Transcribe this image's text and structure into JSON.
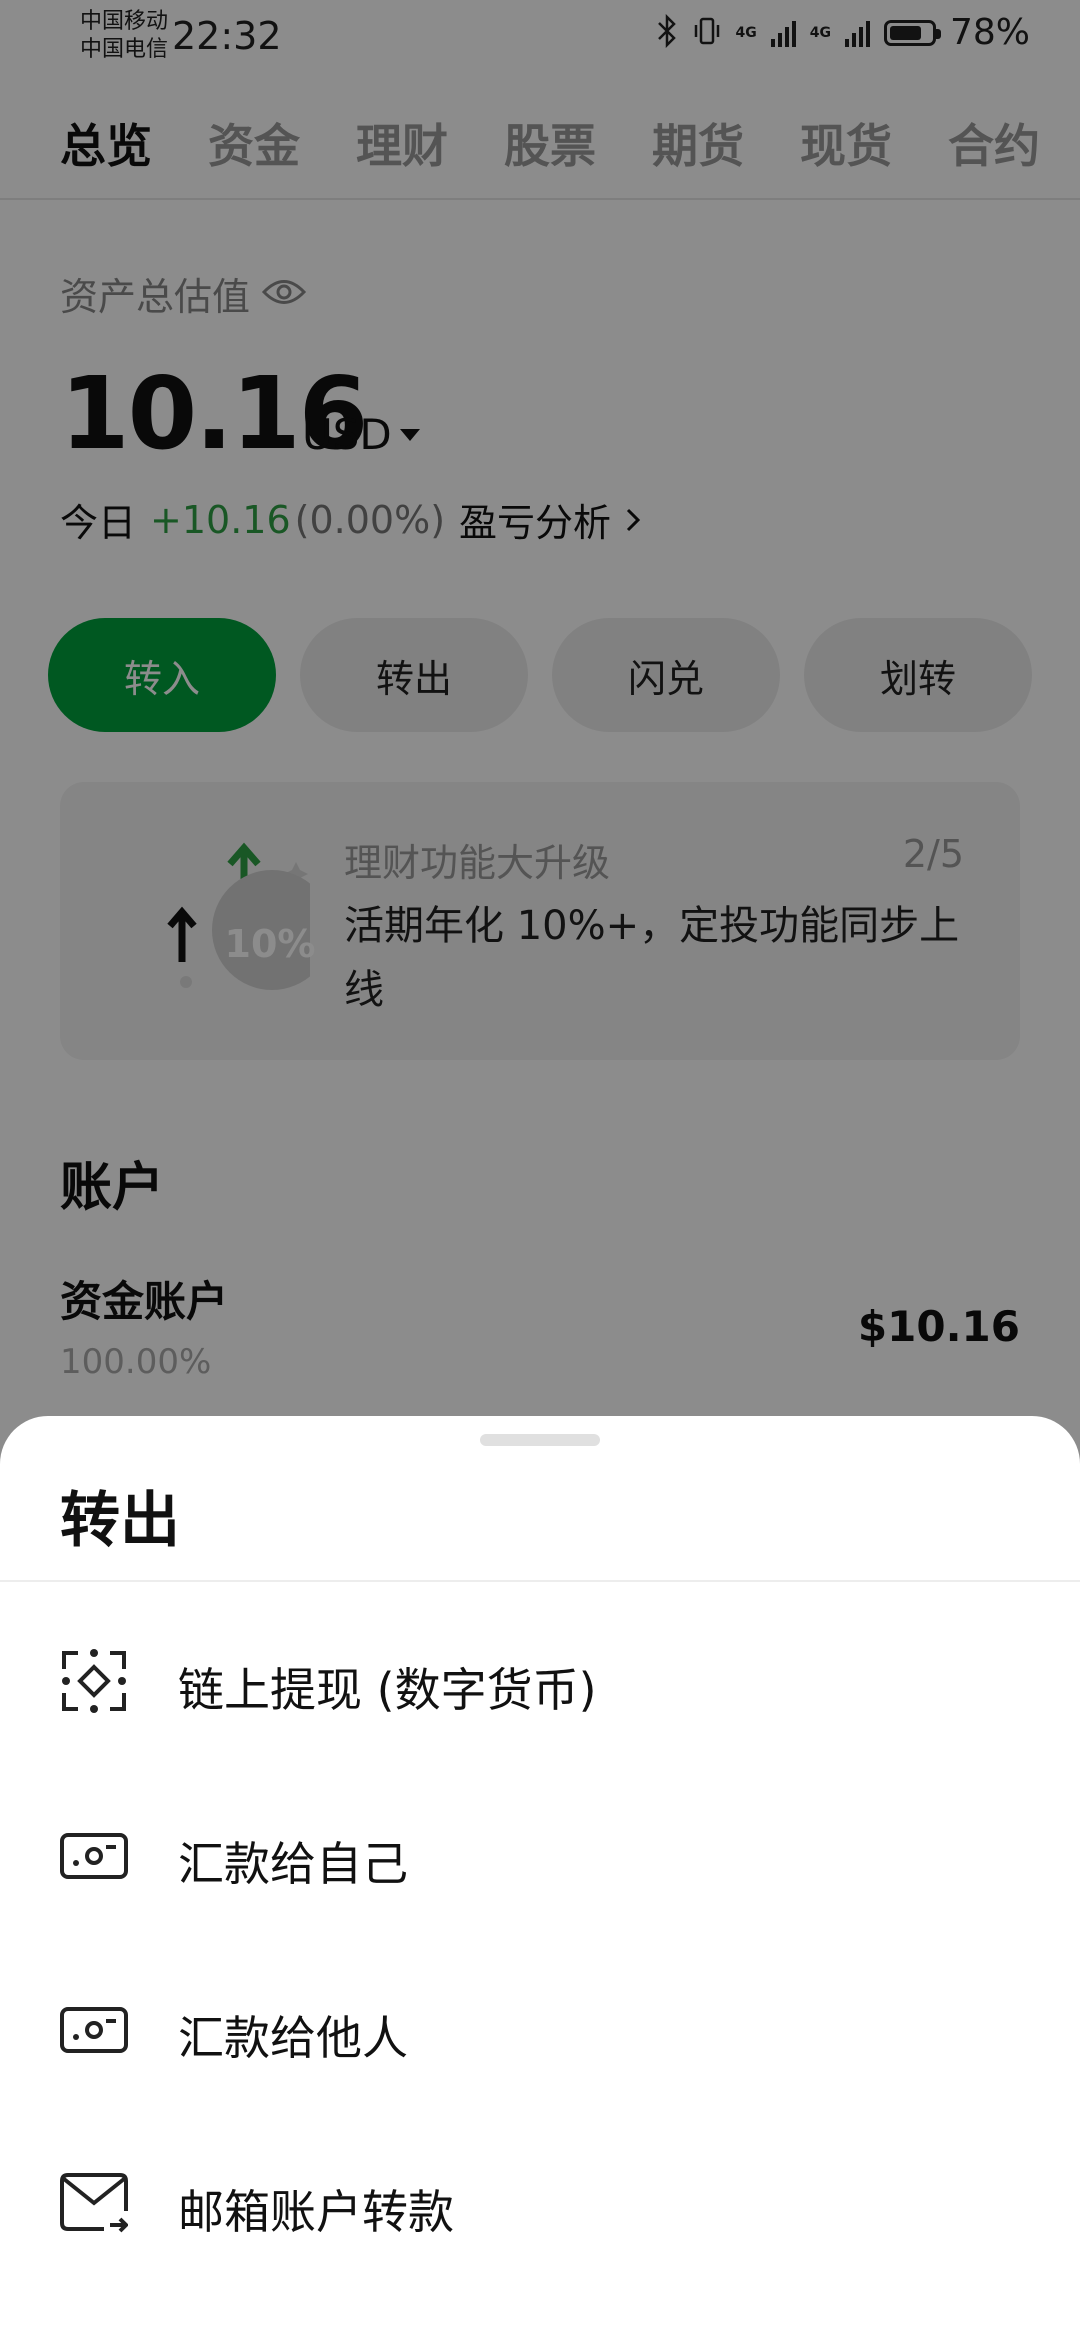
{
  "status_bar": {
    "carrier_1": "中国移动",
    "carrier_2": "中国电信",
    "time": "22:32",
    "network_1": "4G",
    "network_2": "4G",
    "battery": "78%",
    "battery_level": 0.78
  },
  "tabs": [
    {
      "label": "总览",
      "active": true
    },
    {
      "label": "资金",
      "active": false
    },
    {
      "label": "理财",
      "active": false
    },
    {
      "label": "股票",
      "active": false
    },
    {
      "label": "期货",
      "active": false
    },
    {
      "label": "现货",
      "active": false
    },
    {
      "label": "合约",
      "active": false
    }
  ],
  "asset": {
    "label": "资产总估值",
    "amount": "10.16",
    "currency": "USD",
    "today_label": "今日",
    "today_change": "+10.16",
    "today_pct": "(0.00%)",
    "pnl_link": "盈亏分析"
  },
  "actions": [
    {
      "label": "转入",
      "primary": true
    },
    {
      "label": "转出",
      "primary": false
    },
    {
      "label": "闪兑",
      "primary": false
    },
    {
      "label": "划转",
      "primary": false
    }
  ],
  "banner": {
    "title": "理财功能大升级",
    "page": "2/5",
    "text": "活期年化 10%+，定投功能同步上线",
    "badge": "10%"
  },
  "account": {
    "heading": "账户",
    "name": "资金账户",
    "pct": "100.00%",
    "value": "$10.16"
  },
  "sheet": {
    "title": "转出",
    "items": [
      {
        "label": "链上提现 (数字货币)",
        "icon": "onchain-icon"
      },
      {
        "label": "汇款给自己",
        "icon": "cash-icon"
      },
      {
        "label": "汇款给他人",
        "icon": "cash-icon"
      },
      {
        "label": "邮箱账户转款",
        "icon": "mail-transfer-icon"
      }
    ]
  },
  "colors": {
    "accent": "#00a03c",
    "positive": "#2f9e44"
  }
}
